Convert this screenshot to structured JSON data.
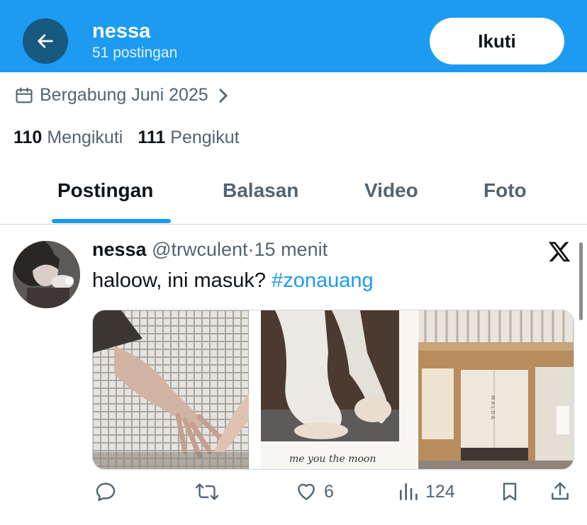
{
  "header": {
    "name": "nessa",
    "post_count": "51 postingan",
    "follow_label": "Ikuti",
    "back_icon": "arrow-left-icon",
    "background": "#1d9bf0"
  },
  "profile": {
    "joined": "Bergabung Juni 2025",
    "following_count": "110",
    "following_label": "Mengikuti",
    "followers_count": "111",
    "followers_label": "Pengikut"
  },
  "tabs": [
    {
      "label": "Postingan",
      "active": true
    },
    {
      "label": "Balasan",
      "active": false
    },
    {
      "label": "Video",
      "active": false
    },
    {
      "label": "Foto",
      "active": false
    }
  ],
  "post": {
    "author": "nessa",
    "handle": "@trwculent",
    "separator": "·",
    "time": "15 menit",
    "text": "haloow, ini masuk? ",
    "hashtag": "#zonauang",
    "media_caption": "me you the moon",
    "store_sign": "M A L D A",
    "actions": {
      "reply_count": "",
      "repost_count": "",
      "like_count": "6",
      "view_count": "124"
    }
  },
  "colors": {
    "accent": "#1d9bf0",
    "text_primary": "#0f1419",
    "text_secondary": "#536471",
    "back_button": "#18597f"
  }
}
